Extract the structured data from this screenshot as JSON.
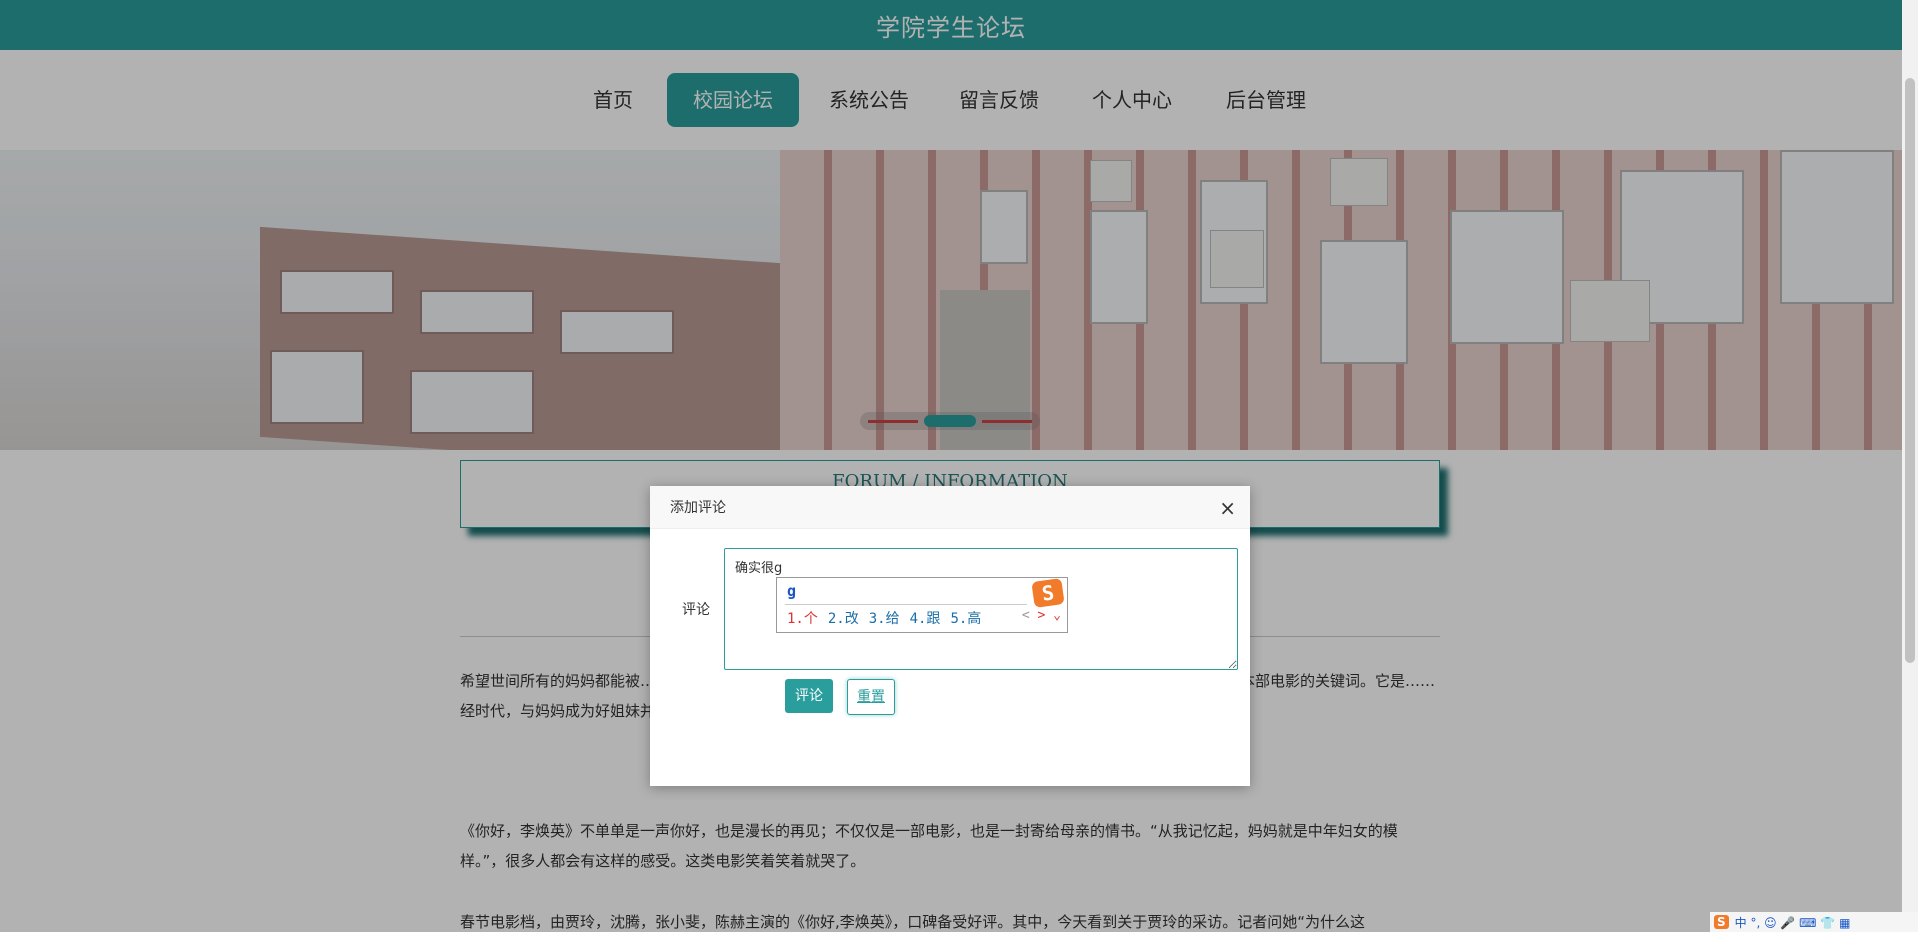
{
  "header": {
    "title": "学院学生论坛"
  },
  "nav": {
    "items": [
      {
        "label": "首页",
        "active": false
      },
      {
        "label": "校园论坛",
        "active": true
      },
      {
        "label": "系统公告",
        "active": false
      },
      {
        "label": "留言反馈",
        "active": false
      },
      {
        "label": "个人中心",
        "active": false
      },
      {
        "label": "后台管理",
        "active": false
      }
    ]
  },
  "banner": {
    "slide_count": 3,
    "active_slide": 2
  },
  "section": {
    "title": "FORUM / INFORMATION"
  },
  "article": {
    "paragraphs": [
      "希望世间所有的妈妈都能被……好，李焕英》献上了片尾曲，是什么原因能让贾玲的……的真实经历改编而成，亲情是本部电影的关键词。它是……经时代，与妈妈成为好姐妹并帮妈妈追求心爱男生的故……",
      "《你好，李焕英》不单单是一声你好，也是漫长的再见；不仅仅是一部电影，也是一封寄给母亲的情书。“从我记忆起，妈妈就是中年妇女的模样。”，很多人都会有这样的感受。这类电影笑着笑着就哭了。",
      "春节电影档，由贾玲，沈腾，张小斐，陈赫主演的《你好,李焕英》，口碑备受好评。其中，今天看到关于贾玲的采访。记者问她“为什么这"
    ]
  },
  "dialog": {
    "title": "添加评论",
    "close_label": "×",
    "field_label": "评论",
    "comment_value": "确实很g",
    "submit_label": "评论",
    "reset_label": "重置"
  },
  "ime": {
    "composition": "g",
    "logo": "S",
    "candidates": [
      "1.个",
      "2.改",
      "3.给",
      "4.跟",
      "5.高"
    ],
    "prev": "<",
    "next": ">",
    "expand": "⌄"
  },
  "tray": {
    "logo": "S",
    "text": "中 °, ☺ 🎤 ⌨ 👕 ▦"
  },
  "colors": {
    "accent": "#2a9d9d",
    "ime_brand": "#f27a2b"
  }
}
